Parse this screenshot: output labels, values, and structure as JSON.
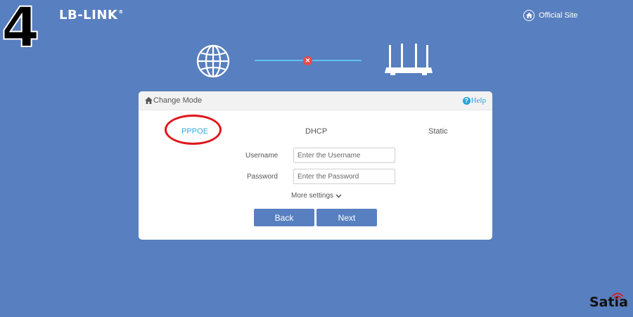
{
  "step_number": "4",
  "brand": {
    "name": "LB-LINK",
    "trademark": "®"
  },
  "header": {
    "official_site": "Official Site"
  },
  "icons": {
    "globe": "globe-icon",
    "router": "router-icon",
    "disconnect": "close-icon",
    "home": "home-icon",
    "help": "help-icon",
    "chevron": "chevron-down-icon"
  },
  "colors": {
    "background": "#587fbf",
    "accent": "#33a8dd",
    "button": "#5880c0",
    "error": "#e94b4b",
    "highlight": "#e0161b"
  },
  "panel": {
    "title": "Change Mode",
    "help": "Help",
    "modes": {
      "pppoe": "PPPOE",
      "dhcp": "DHCP",
      "static": "Static"
    },
    "selected_mode": "PPPOE",
    "username": {
      "label": "Username",
      "value": "",
      "placeholder": "Enter the Username"
    },
    "password": {
      "label": "Password",
      "value": "",
      "placeholder": "Enter the Password"
    },
    "more_settings": "More settings",
    "back": "Back",
    "next": "Next"
  },
  "watermark": "Satia"
}
